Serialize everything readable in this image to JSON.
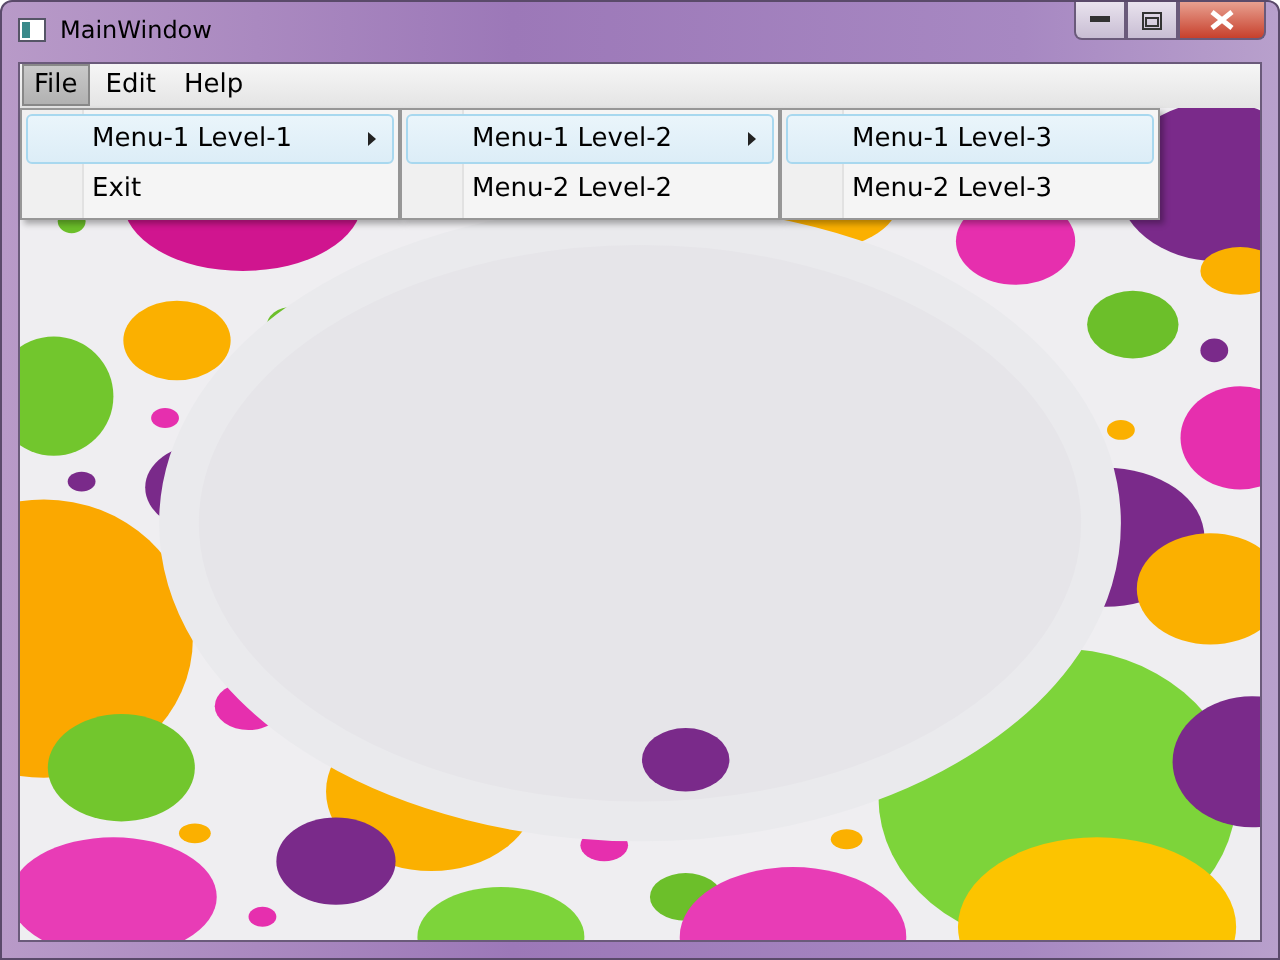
{
  "window": {
    "title": "MainWindow"
  },
  "menu_bar": [
    {
      "label": "File",
      "selected": true
    },
    {
      "label": "Edit",
      "selected": false
    },
    {
      "label": "Help",
      "selected": false
    }
  ],
  "menus": [
    {
      "items": [
        {
          "label": "Menu-1 Level-1",
          "selected": true,
          "has_submenu": true
        },
        {
          "label": "Exit",
          "selected": false,
          "has_submenu": false
        }
      ]
    },
    {
      "items": [
        {
          "label": "Menu-1 Level-2",
          "selected": true,
          "has_submenu": true
        },
        {
          "label": "Menu-2 Level-2",
          "selected": false,
          "has_submenu": false
        }
      ]
    },
    {
      "items": [
        {
          "label": "Menu-1 Level-3",
          "selected": true,
          "has_submenu": false
        },
        {
          "label": "Menu-2 Level-3",
          "selected": false,
          "has_submenu": false
        }
      ]
    }
  ]
}
